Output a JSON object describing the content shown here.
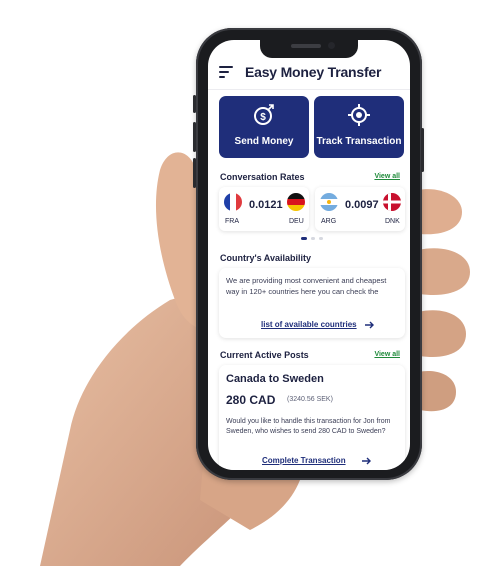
{
  "app": {
    "title": "Easy Money Transfer"
  },
  "actions": {
    "send": {
      "label": "Send Money",
      "icon": "money-send-icon"
    },
    "track": {
      "label": "Track Transaction",
      "icon": "target-icon"
    }
  },
  "rates_section": {
    "title": "Conversation Rates",
    "view_all": "View all",
    "cards": [
      {
        "from": "FRA",
        "to": "DEU",
        "rate": "0.0121"
      },
      {
        "from": "ARG",
        "to": "DNK",
        "rate": "0.0097"
      }
    ],
    "pager": {
      "active": 0,
      "count": 3
    }
  },
  "availability": {
    "title": "Country's Availability",
    "text": "We are providing most convenient and cheapest way in 120+ countries here you can check the",
    "link": "list of available countries"
  },
  "posts": {
    "title": "Current Active Posts",
    "view_all": "View all",
    "items": [
      {
        "route": "Canada to Sweden",
        "amount": "280 CAD",
        "converted": "(3240.56 SEK)",
        "description": "Would you like to handle this transaction for Jon from Sweden, who wishes to send 280 CAD to Sweden?",
        "action": "Complete Transaction"
      }
    ]
  },
  "colors": {
    "primary": "#1f2e7a",
    "accent_green": "#1f8a3a",
    "text_dark": "#1d2140"
  }
}
